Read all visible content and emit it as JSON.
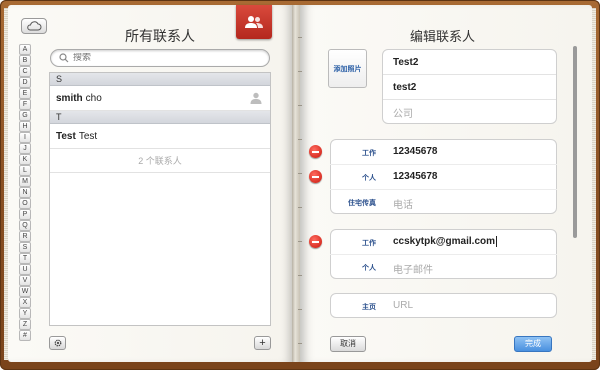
{
  "left_page": {
    "title": "所有联系人",
    "search_placeholder": "搜索",
    "index_letters": [
      "A",
      "B",
      "C",
      "D",
      "E",
      "F",
      "G",
      "H",
      "I",
      "J",
      "K",
      "L",
      "M",
      "N",
      "O",
      "P",
      "Q",
      "R",
      "S",
      "T",
      "U",
      "V",
      "W",
      "X",
      "Y",
      "Z",
      "#"
    ],
    "sections": [
      {
        "header": "S",
        "contacts": [
          {
            "first": "smith",
            "last": "cho"
          }
        ]
      },
      {
        "header": "T",
        "contacts": [
          {
            "first": "Test",
            "last": "Test"
          }
        ]
      }
    ],
    "contact_count": "2 个联系人",
    "settings_icon": "gear-icon",
    "add_label": "+"
  },
  "right_page": {
    "title": "编辑联系人",
    "add_photo_label": "添加照片",
    "name": {
      "first": "Test2",
      "last": "test2",
      "company_placeholder": "公司"
    },
    "phones": [
      {
        "label": "工作",
        "value": "12345678",
        "removable": true
      },
      {
        "label": "个人",
        "value": "12345678",
        "removable": true
      },
      {
        "label": "住宅传真",
        "value": "",
        "placeholder": "电话",
        "removable": false
      }
    ],
    "emails": [
      {
        "label": "工作",
        "value": "ccskytpk@gmail.com",
        "removable": true
      },
      {
        "label": "个人",
        "value": "",
        "placeholder": "电子邮件",
        "removable": false
      }
    ],
    "urls": [
      {
        "label": "主页",
        "value": "",
        "placeholder": "URL"
      }
    ],
    "cancel_label": "取消",
    "done_label": "完成"
  },
  "colors": {
    "accent_blue": "#4a90df",
    "delete_red": "#d9261b",
    "leather": "#8a5022",
    "bookmark_red": "#c8392c"
  }
}
